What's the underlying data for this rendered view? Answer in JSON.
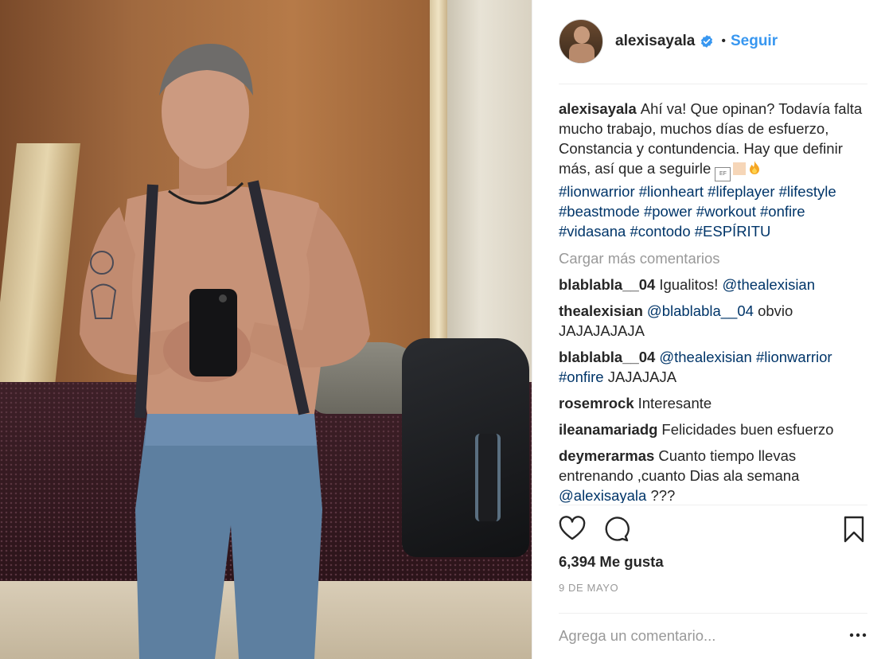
{
  "post": {
    "image_alt": "Shirtless man with suspenders taking a mirror selfie",
    "author": {
      "username": "alexisayala",
      "verified": true,
      "follow_label": "Seguir",
      "separator": "•"
    },
    "caption": {
      "username": "alexisayala",
      "text_1": "Ahí va! Que opinan? Todavía falta mucho trabajo, muchos días de esfuerzo, Constancia y contundencia. Hay que definir más, así que a seguirle",
      "hashtags": [
        "#lionwarrior",
        "#lionheart",
        "#lifeplayer",
        "#lifestyle",
        "#beastmode",
        "#power",
        "#workout",
        "#onfire",
        "#vidasana",
        "#contodo",
        "#ESPÍRITU"
      ]
    },
    "load_more_label": "Cargar más comentarios",
    "comments": [
      {
        "username": "blablabla__04",
        "text": "Igualitos!",
        "mention": "@thealexisian",
        "after": ""
      },
      {
        "username": "thealexisian",
        "text": "",
        "mention": "@blablabla__04",
        "after": "obvio JAJAJAJAJA"
      },
      {
        "username": "blablabla__04",
        "text": "",
        "mention": "@thealexisian #lionwarrior #onfire",
        "after": "JAJAJAJA"
      },
      {
        "username": "rosemrock",
        "text": "Interesante",
        "mention": "",
        "after": ""
      },
      {
        "username": "ileanamariadg",
        "text": "Felicidades buen esfuerzo",
        "mention": "",
        "after": ""
      },
      {
        "username": "deymerarmas",
        "text": "Cuanto tiempo llevas entrenando ,cuanto Dias ala semana",
        "mention": "@alexisayala",
        "after": "???"
      }
    ],
    "likes_label": "6,394 Me gusta",
    "date_label": "9 DE MAYO",
    "comment_placeholder": "Agrega un comentario...",
    "options_label": "•••"
  },
  "icons": {
    "like": "heart-icon",
    "comment": "comment-bubble-icon",
    "save": "bookmark-icon",
    "verified": "verified-badge-icon",
    "options": "more-options-icon"
  },
  "colors": {
    "link": "#3897f0",
    "hashtag": "#003569",
    "muted": "#999999",
    "text": "#262626"
  }
}
